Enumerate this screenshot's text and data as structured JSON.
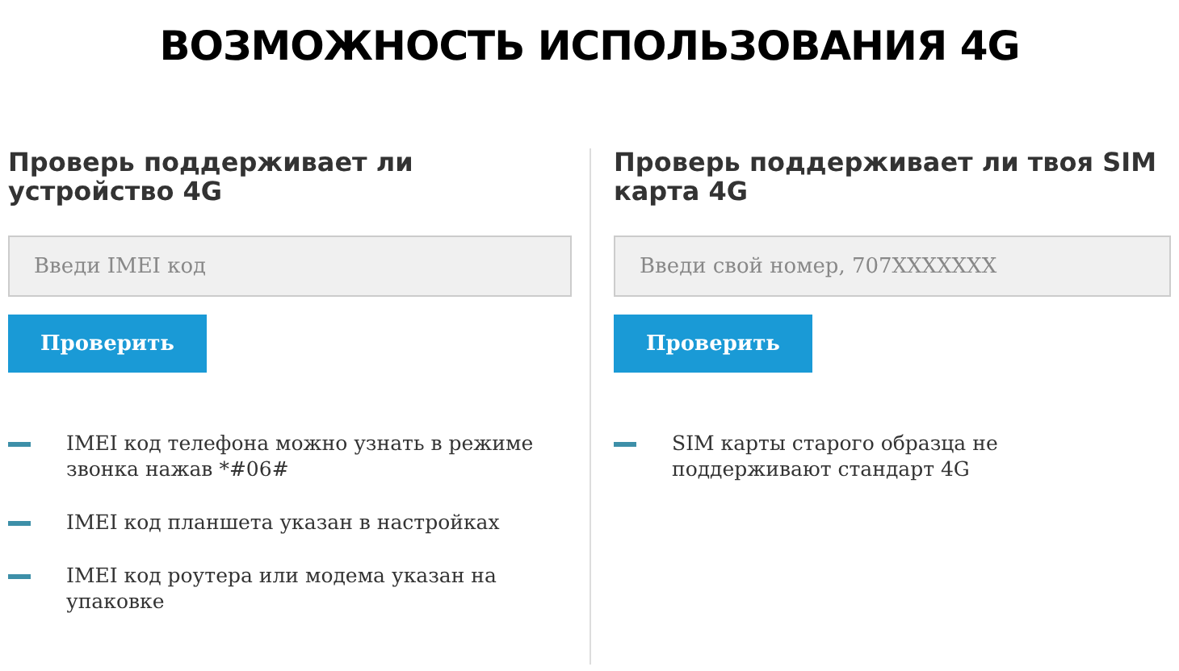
{
  "title": "ВОЗМОЖНОСТЬ ИСПОЛЬЗОВАНИЯ 4G",
  "columns": [
    {
      "heading": "Проверь поддерживает ли устройство 4G",
      "placeholder": "Введи IMEI код",
      "button": "Проверить",
      "notes": [
        "IMEI код телефона можно узнать в режиме звонка нажав *#06#",
        "IMEI код планшета указан в настройках",
        "IMEI код роутера или модема указан на упаковке"
      ]
    },
    {
      "heading": "Проверь поддерживает ли твоя SIM карта 4G",
      "placeholder": "Введи свой номер, 707XXXXXXX",
      "button": "Проверить",
      "notes": [
        "SIM карты старого образца не поддерживают стандарт 4G"
      ]
    }
  ]
}
